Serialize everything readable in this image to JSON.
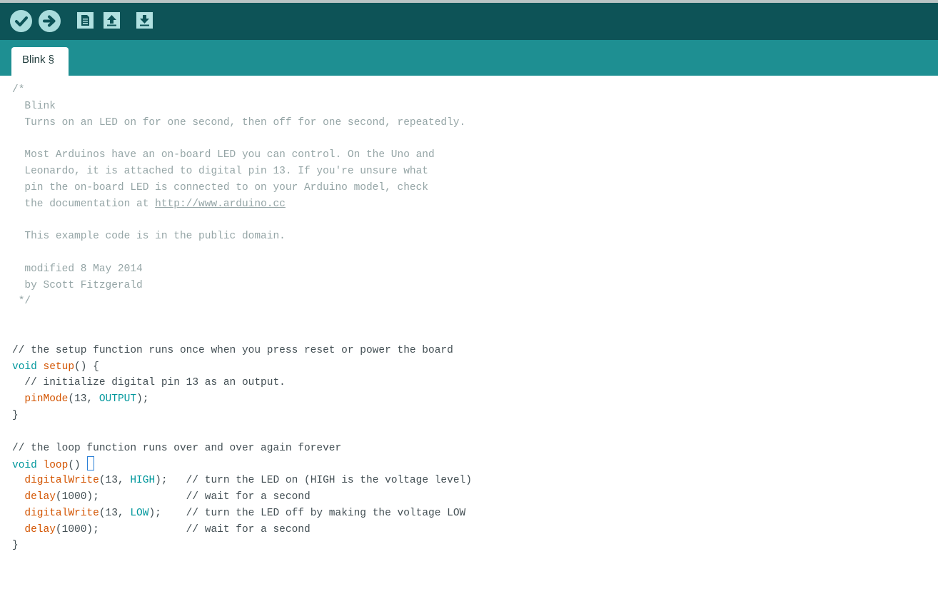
{
  "colors": {
    "toolbar_bg": "#0d5357",
    "tabbar_bg": "#1e8f92",
    "toolbar_button": "#a9dcdc",
    "comment": "#95a5a6",
    "keyword": "#00979c",
    "function": "#d35400",
    "text": "#434f54"
  },
  "toolbar": {
    "verify_icon": "checkmark-icon",
    "upload_icon": "arrow-right-icon",
    "new_icon": "document-icon",
    "open_icon": "arrow-up-icon",
    "save_icon": "arrow-down-icon"
  },
  "tab": {
    "label": "Blink §"
  },
  "code": {
    "l1": "/*",
    "l2": "  Blink",
    "l3": "  Turns on an LED on for one second, then off for one second, repeatedly.",
    "l4": "",
    "l5": "  Most Arduinos have an on-board LED you can control. On the Uno and",
    "l6": "  Leonardo, it is attached to digital pin 13. If you're unsure what",
    "l7": "  pin the on-board LED is connected to on your Arduino model, check",
    "l8a": "  the documentation at ",
    "l8b": "http://www.arduino.cc",
    "l9": "",
    "l10": "  This example code is in the public domain.",
    "l11": "",
    "l12": "  modified 8 May 2014",
    "l13": "  by Scott Fitzgerald",
    "l14": " */",
    "l15": "",
    "l16": "",
    "l17": "// the setup function runs once when you press reset or power the board",
    "l18a": "void",
    "l18b": " ",
    "l18c": "setup",
    "l18d": "() {",
    "l19": "  // initialize digital pin 13 as an output.",
    "l20a": "  ",
    "l20b": "pinMode",
    "l20c": "(13, ",
    "l20d": "OUTPUT",
    "l20e": ");",
    "l21": "}",
    "l22": "",
    "l23": "// the loop function runs over and over again forever",
    "l24a": "void",
    "l24b": " ",
    "l24c": "loop",
    "l24d": "() ",
    "l25a": "  ",
    "l25b": "digitalWrite",
    "l25c": "(13, ",
    "l25d": "HIGH",
    "l25e": ");   ",
    "l25f": "// turn the LED on (HIGH is the voltage level)",
    "l26a": "  ",
    "l26b": "delay",
    "l26c": "(1000);              ",
    "l26d": "// wait for a second",
    "l27a": "  ",
    "l27b": "digitalWrite",
    "l27c": "(13, ",
    "l27d": "LOW",
    "l27e": ");    ",
    "l27f": "// turn the LED off by making the voltage LOW",
    "l28a": "  ",
    "l28b": "delay",
    "l28c": "(1000);              ",
    "l28d": "// wait for a second",
    "l29": "}"
  }
}
